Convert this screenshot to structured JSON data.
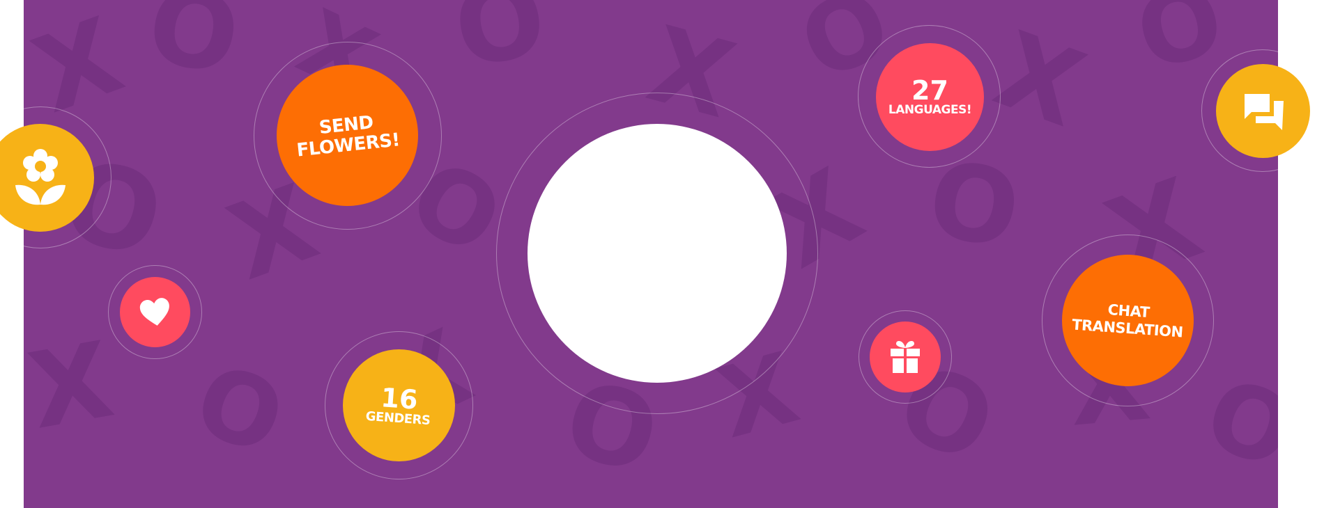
{
  "features": {
    "send_flowers": {
      "line1": "SEND",
      "line2": "FLOWERS!"
    },
    "languages": {
      "number": "27",
      "label": "LANGUAGES!"
    },
    "genders": {
      "number": "16",
      "label": "GENDERS"
    },
    "chat_translation": {
      "line1": "CHAT",
      "line2": "TRANSLATION"
    }
  },
  "icons": [
    "flower-icon",
    "heart-icon",
    "gift-icon",
    "chat-icon"
  ],
  "colors": {
    "background": "#823a8c",
    "orange": "#fd6e04",
    "yellow": "#f7b217",
    "pink": "#ff4b5f",
    "white": "#ffffff"
  }
}
